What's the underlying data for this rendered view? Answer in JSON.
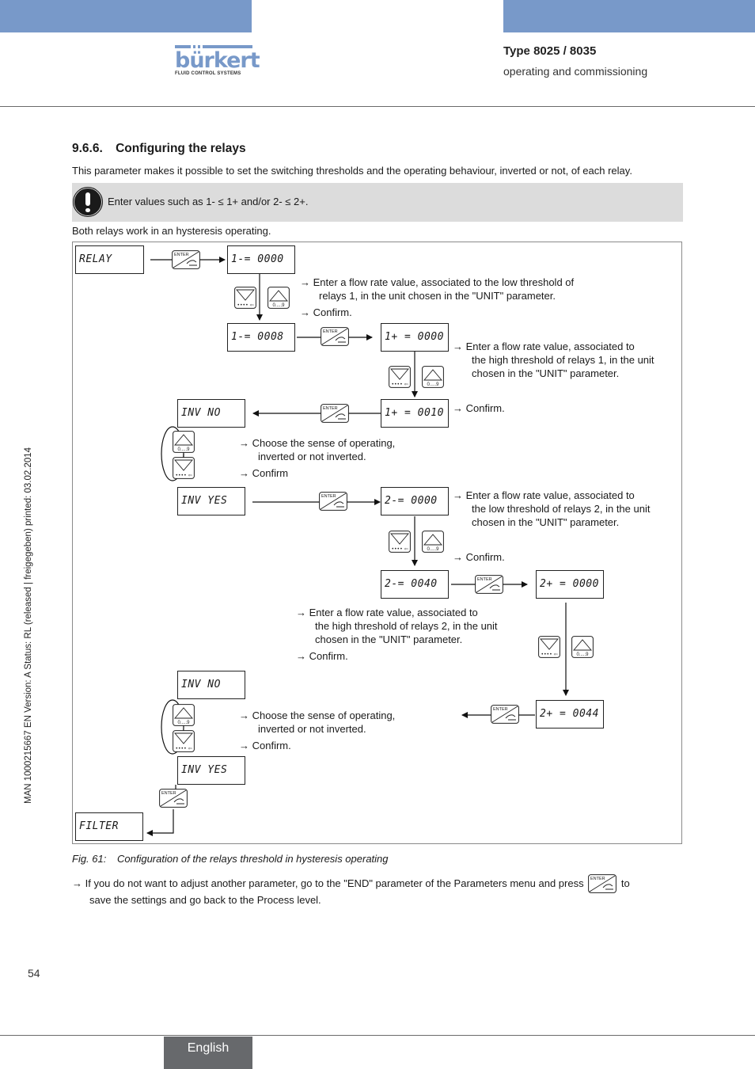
{
  "header": {
    "logo": {
      "name": "bürkert",
      "tagline": "FLUID CONTROL SYSTEMS"
    },
    "type": "Type 8025 / 8035",
    "subtitle": "operating and commissioning",
    "accent_color": "#7899c9"
  },
  "section": {
    "number": "9.6.6.",
    "title": "Configuring the relays",
    "intro": "This parameter makes it possible to set the switching thresholds and the operating behaviour, inverted or not, of each relay.",
    "note_icon": "warning-exclamation-icon",
    "note": "Enter values such as 1- ≤ 1+ and/or 2- ≤ 2+.",
    "after_note": "Both relays work in an hysteresis operating."
  },
  "keys": {
    "enter": "ENTER",
    "up_label": "0.....9",
    "down_label": "•••• ⇦"
  },
  "diagram": {
    "displays": {
      "relay": "RELAY",
      "r1_low_0": "1-=  0000",
      "r1_low_1": "1-=  0008",
      "r1_high_0": "1+ = 0000",
      "r1_high_1": "1+ = 0010",
      "inv1_no": "INV NO",
      "inv1_yes": "INV YES",
      "r2_low_0": "2-=  0000",
      "r2_low_1": "2-=  0040",
      "r2_high_0": "2+ = 0000",
      "r2_high_1": "2+ = 0044",
      "inv2_no": "INV NO",
      "inv2_yes": "INV YES",
      "filter": "FILTER"
    },
    "notes": {
      "r1_low": [
        "→ Enter a flow rate value, associated to the low threshold of",
        "relays 1, in the unit chosen in the \"UNIT\" parameter."
      ],
      "r1_low_confirm": "→ Confirm.",
      "r1_high": [
        "→ Enter a flow rate value, associated to",
        "the high threshold of relays 1, in the unit",
        "chosen in the \"UNIT\" parameter."
      ],
      "r1_high_confirm": "→ Confirm.",
      "inv1": [
        "→ Choose the sense of operating,",
        "inverted or not inverted."
      ],
      "inv1_confirm": "→ Confirm",
      "r2_low": [
        "→ Enter a flow rate value, associated to",
        "the low threshold of relays 2, in the unit",
        "chosen in the \"UNIT\" parameter."
      ],
      "r2_low_confirm": "→ Confirm.",
      "r2_high": [
        "→ Enter a flow rate value, associated to",
        "the high threshold of relays 2, in the unit",
        "chosen in the \"UNIT\" parameter."
      ],
      "r2_high_confirm": "→ Confirm.",
      "inv2": [
        "→ Choose the sense of operating,",
        "inverted or not inverted."
      ],
      "inv2_confirm": "→ Confirm."
    }
  },
  "caption": {
    "label": "Fig. 61:",
    "text": "Configuration of the relays threshold in hysteresis operating"
  },
  "footer_note": {
    "before": "→ If you do not want to adjust another parameter, go to the \"END\" parameter of the Parameters menu and press",
    "after": "to",
    "line2": "save the settings and go back to the Process level."
  },
  "side_text": "MAN  1000215667  EN  Version: A  Status: RL (released | freigegeben)  printed: 03.02.2014",
  "page_number": "54",
  "language_tab": "English"
}
